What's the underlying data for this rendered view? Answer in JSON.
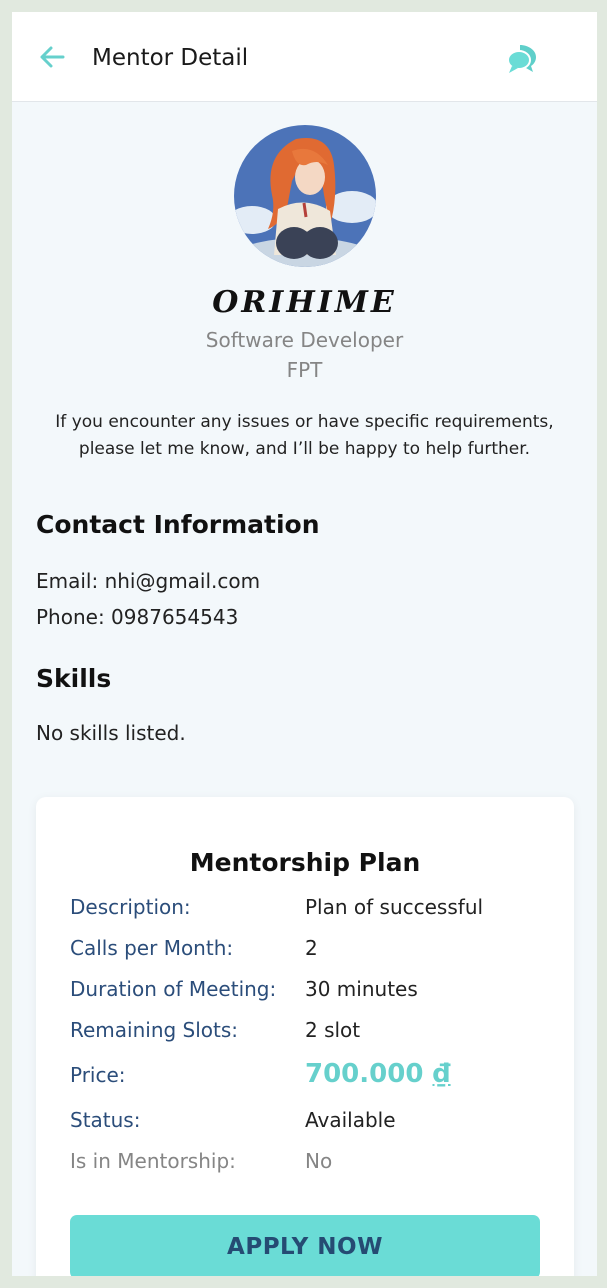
{
  "header": {
    "title": "Mentor Detail",
    "back_icon": "arrow-left-icon",
    "chat_icon": "chat-bubbles-icon"
  },
  "profile": {
    "name": "ORIHIME",
    "role": "Software Developer",
    "company": "FPT",
    "intro": "If you encounter any issues or have specific requirements, please let me know, and I’ll be happy to help further."
  },
  "contact": {
    "heading": "Contact Information",
    "email": "Email: nhi@gmail.com",
    "phone": "Phone: 0987654543"
  },
  "skills": {
    "heading": "Skills",
    "empty": "No skills listed."
  },
  "plan": {
    "title": "Mentorship Plan",
    "description_label": "Description:",
    "description_value": "Plan of successful",
    "calls_label": "Calls per Month:",
    "calls_value": "2",
    "duration_label": "Duration of Meeting:",
    "duration_value": "30 minutes",
    "slots_label": "Remaining Slots:",
    "slots_value": "2 slot",
    "price_label": "Price:",
    "price_amount": "700.000",
    "price_currency": "₫",
    "status_label": "Status:",
    "status_value": "Available",
    "mentorship_label": "Is in Mentorship:",
    "mentorship_value": "No",
    "apply_label": "APPLY NOW"
  },
  "colors": {
    "accent": "#6adcd6",
    "label": "#2b4d7a",
    "muted": "#858585",
    "background": "#f3f8fb"
  }
}
